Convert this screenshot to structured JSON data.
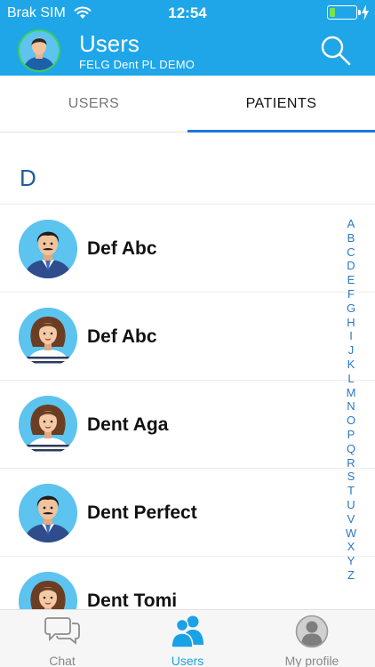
{
  "status_bar": {
    "carrier": "Brak SIM",
    "time": "12:54",
    "battery_level": 0.22
  },
  "header": {
    "title": "Users",
    "subtitle": "FELG Dent PL DEMO",
    "search_icon": "search-icon",
    "background_color": "#1fa6e8"
  },
  "tabs": [
    {
      "label": "USERS",
      "selected": false
    },
    {
      "label": "PATIENTS",
      "selected": true
    }
  ],
  "section_letter": "D",
  "contacts": [
    {
      "name": "Def Abc",
      "avatar": "male-avatar"
    },
    {
      "name": "Def Abc",
      "avatar": "female-avatar"
    },
    {
      "name": "Dent Aga",
      "avatar": "female-avatar"
    },
    {
      "name": "Dent Perfect",
      "avatar": "male-avatar"
    },
    {
      "name": "Dent Tomi",
      "avatar": "female-avatar"
    }
  ],
  "alphabet_index": [
    "A",
    "B",
    "C",
    "D",
    "E",
    "F",
    "G",
    "H",
    "I",
    "J",
    "K",
    "L",
    "M",
    "N",
    "O",
    "P",
    "Q",
    "R",
    "S",
    "T",
    "U",
    "V",
    "W",
    "X",
    "Y",
    "Z"
  ],
  "bottom_tabs": [
    {
      "label": "Chat",
      "icon": "chat-icon",
      "active": false
    },
    {
      "label": "Users",
      "icon": "users-icon",
      "active": true
    },
    {
      "label": "My profile",
      "icon": "profile-icon",
      "active": false
    }
  ],
  "accent_color": "#1aa2e6"
}
